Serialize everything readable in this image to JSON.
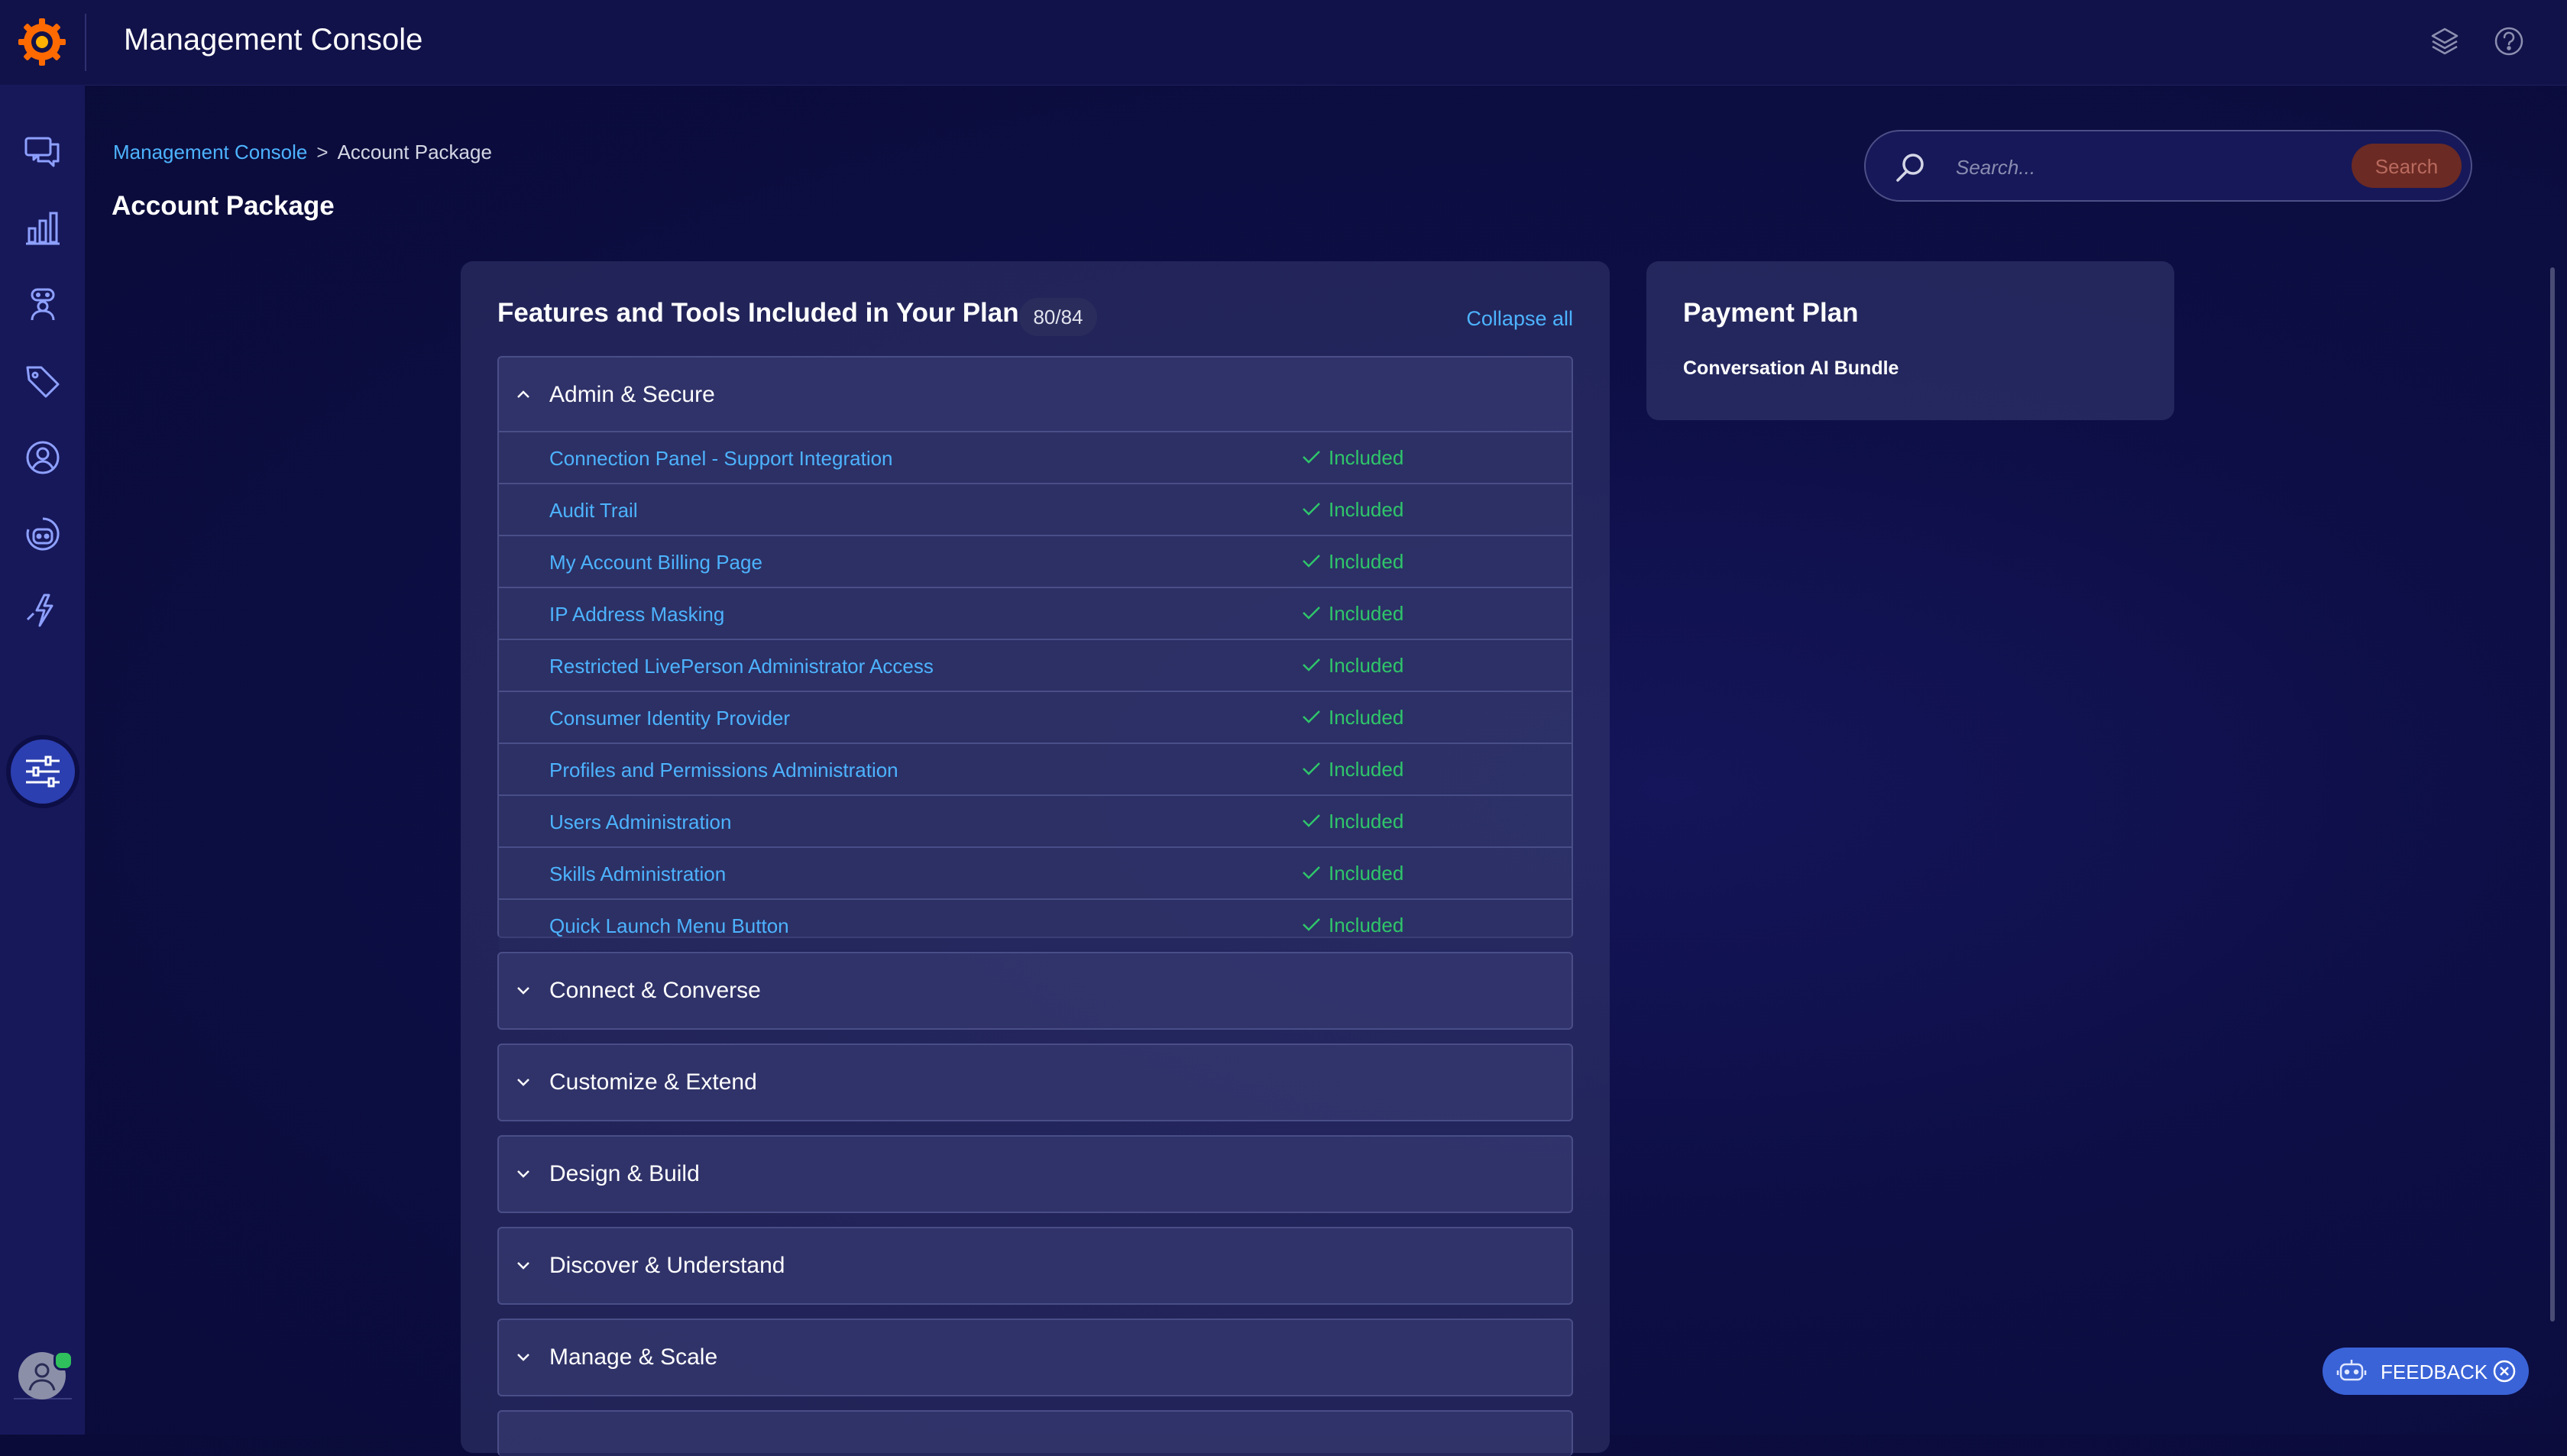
{
  "app": {
    "title": "Management Console"
  },
  "breadcrumb": {
    "root": "Management Console",
    "separator": ">",
    "current": "Account Package"
  },
  "page": {
    "title": "Account Package"
  },
  "search": {
    "placeholder": "Search...",
    "button_label": "Search"
  },
  "features": {
    "title": "Features and Tools Included in Your Plan",
    "count": "80/84",
    "collapse_all_label": "Collapse all",
    "open_section": {
      "label": "Admin & Secure",
      "items": [
        {
          "name": "Connection Panel - Support Integration",
          "status": "Included"
        },
        {
          "name": "Audit Trail",
          "status": "Included"
        },
        {
          "name": "My Account Billing Page",
          "status": "Included"
        },
        {
          "name": "IP Address Masking",
          "status": "Included"
        },
        {
          "name": "Restricted LivePerson Administrator Access",
          "status": "Included"
        },
        {
          "name": "Consumer Identity Provider",
          "status": "Included"
        },
        {
          "name": "Profiles and Permissions Administration",
          "status": "Included"
        },
        {
          "name": "Users Administration",
          "status": "Included"
        },
        {
          "name": "Skills Administration",
          "status": "Included"
        },
        {
          "name": "Quick Launch Menu Button",
          "status": "Included"
        }
      ]
    },
    "collapsed_sections": [
      "Connect & Converse",
      "Customize & Extend",
      "Design & Build",
      "Discover & Understand",
      "Manage & Scale"
    ]
  },
  "payment_plan": {
    "title": "Payment Plan",
    "plan": "Conversation AI Bundle"
  },
  "feedback": {
    "label": "FEEDBACK"
  },
  "icons": {
    "logo": "liveperson-logo-icon",
    "top_right": [
      "layers-icon",
      "help-icon"
    ],
    "sidebar": [
      "conversations-icon",
      "analytics-icon",
      "agent-icon",
      "tag-icon",
      "user-profile-icon",
      "bot-icon",
      "automation-icon",
      "settings-sliders-icon"
    ]
  },
  "colors": {
    "accent_link": "#4db3ff",
    "included": "#2fc66a",
    "active_nav": "#2c3fb0",
    "search_button": "#6b2a24",
    "feedback_button": "#3a63d8"
  }
}
